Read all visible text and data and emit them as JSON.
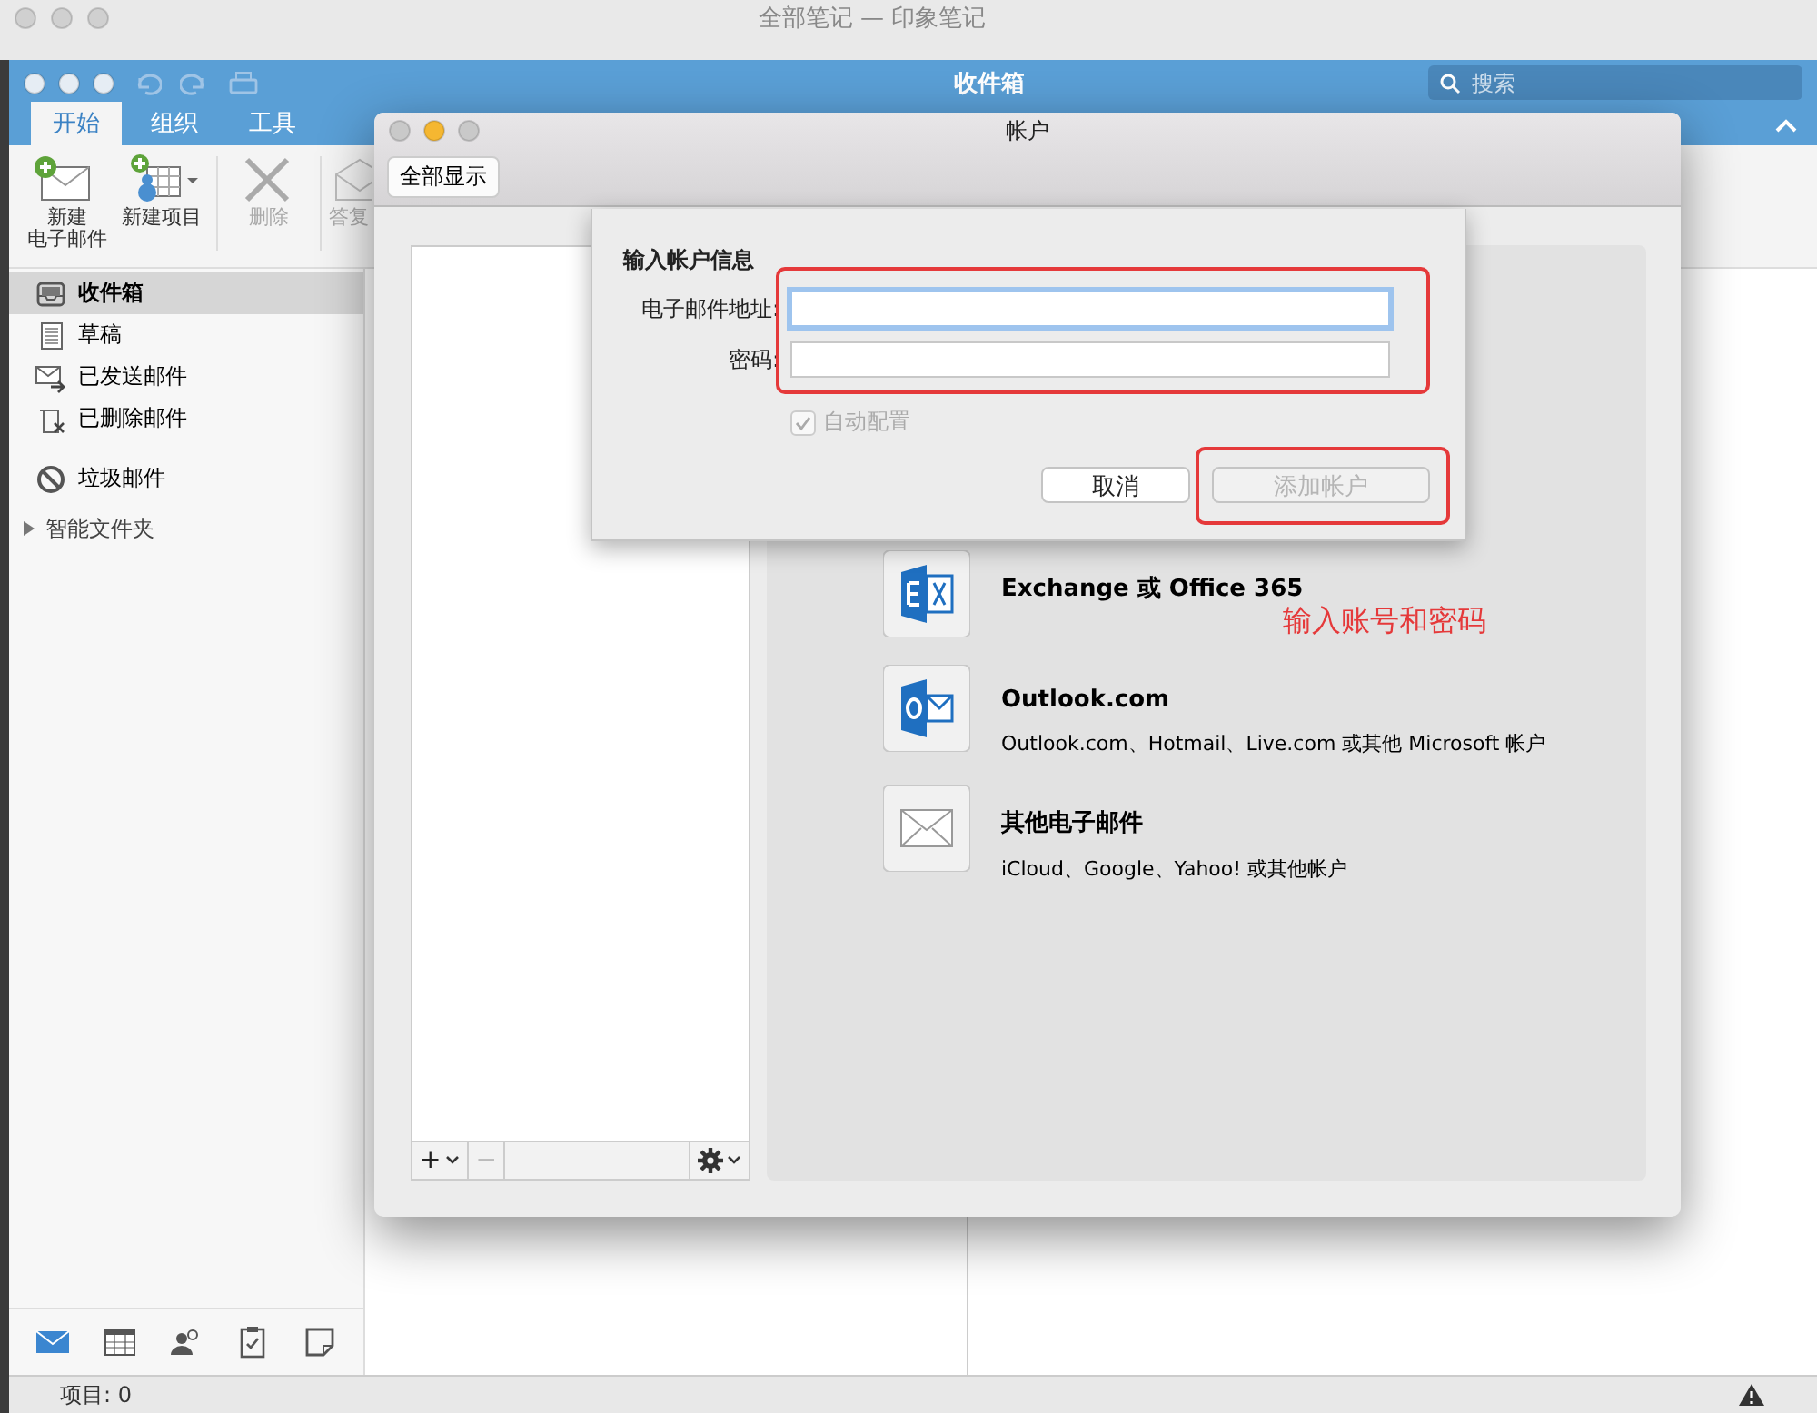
{
  "background_window": {
    "title": "全部笔记 — 印象笔记"
  },
  "outlook": {
    "title": "收件箱",
    "search": {
      "placeholder": "搜索"
    },
    "tabs": [
      {
        "label": "开始",
        "selected": true
      },
      {
        "label": "组织",
        "selected": false
      },
      {
        "label": "工具",
        "selected": false
      }
    ],
    "ribbon": [
      {
        "kind": "new-mail",
        "lines": [
          "新建",
          "电子邮件"
        ],
        "disabled": false
      },
      {
        "kind": "new-item",
        "lines": [
          "新建项目"
        ],
        "disabled": false
      },
      {
        "kind": "delete",
        "lines": [
          "删除"
        ],
        "disabled": true
      },
      {
        "kind": "reply",
        "lines": [
          "答复"
        ],
        "disabled": true
      }
    ],
    "folders": [
      {
        "kind": "inbox",
        "label": "收件箱",
        "selected": true
      },
      {
        "kind": "drafts",
        "label": "草稿",
        "selected": false
      },
      {
        "kind": "sent",
        "label": "已发送邮件",
        "selected": false
      },
      {
        "kind": "deleted",
        "label": "已删除邮件",
        "selected": false
      },
      {
        "kind": "junk",
        "label": "垃圾邮件",
        "selected": false
      }
    ],
    "smart_folders": {
      "label": "智能文件夹",
      "expanded": false
    },
    "nav": [
      {
        "kind": "mail",
        "selected": true
      },
      {
        "kind": "calendar",
        "selected": false
      },
      {
        "kind": "people",
        "selected": false
      },
      {
        "kind": "tasks",
        "selected": false
      },
      {
        "kind": "notes",
        "selected": false
      }
    ],
    "status_bar": {
      "items": "项目: 0"
    }
  },
  "accounts_window": {
    "title": "帐户",
    "show_all_button": "全部显示",
    "list_buttons": [
      "+",
      "−"
    ],
    "options": [
      {
        "kind": "exchange",
        "title": "Exchange 或 Office 365"
      },
      {
        "kind": "outlook",
        "title": "Outlook.com",
        "subtitle": "Outlook.com、Hotmail、Live.com 或其他 Microsoft 帐户"
      },
      {
        "kind": "mail",
        "title": "其他电子邮件",
        "subtitle": "iCloud、Google、Yahoo! 或其他帐户"
      }
    ]
  },
  "sheet": {
    "heading": "输入帐户信息",
    "fields": [
      {
        "label": "电子邮件地址:",
        "focused": true
      },
      {
        "label": "密码:",
        "focused": false
      }
    ],
    "auto_config": {
      "label": "自动配置",
      "checked": true,
      "disabled": true
    },
    "buttons": [
      {
        "label": "取消",
        "disabled": false
      },
      {
        "label": "添加帐户",
        "disabled": true
      }
    ]
  },
  "annotation": {
    "text": "输入账号和密码"
  }
}
